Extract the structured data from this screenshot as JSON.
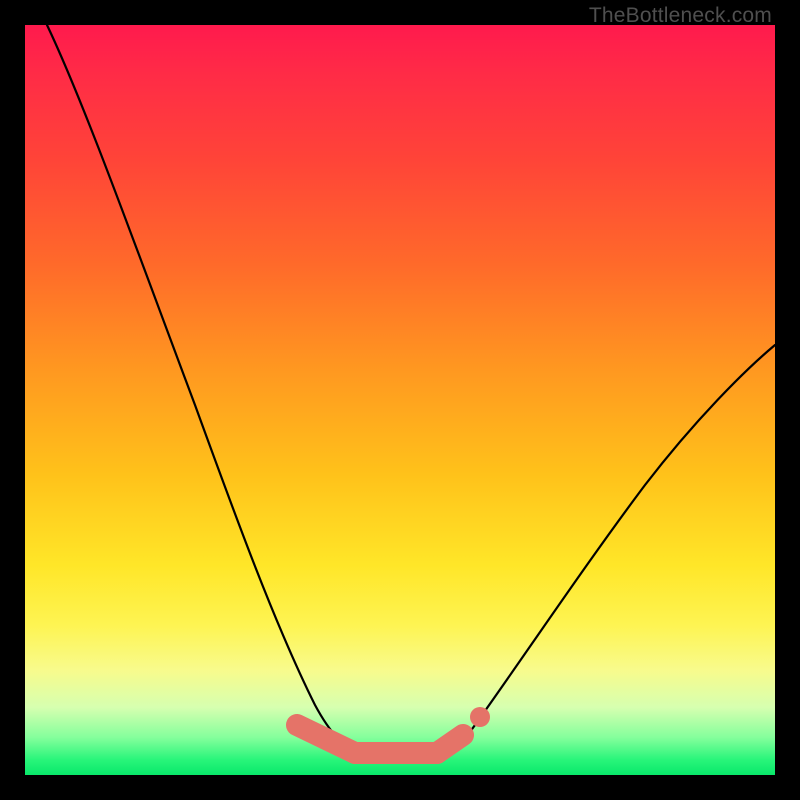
{
  "watermark": "TheBottleneck.com",
  "colors": {
    "frame": "#000000",
    "gradient_top": "#ff1a4d",
    "gradient_mid": "#ffe628",
    "gradient_bottom": "#09e86a",
    "curve": "#000000",
    "marker": "#e57368"
  },
  "chart_data": {
    "type": "line",
    "title": "",
    "xlabel": "",
    "ylabel": "",
    "xlim": [
      0,
      100
    ],
    "ylim": [
      0,
      100
    ],
    "grid": false,
    "legend": false,
    "annotations": [
      "TheBottleneck.com"
    ],
    "series": [
      {
        "name": "value-curve",
        "x": [
          3,
          6,
          10,
          14,
          18,
          22,
          26,
          30,
          33,
          36,
          38,
          40,
          42,
          44,
          46,
          48,
          50,
          54,
          58,
          62,
          66,
          70,
          74,
          78,
          82,
          86,
          90,
          94,
          98,
          100
        ],
        "y": [
          100,
          93,
          84,
          75,
          66,
          57,
          48,
          39,
          31,
          24,
          19,
          14,
          10,
          6,
          4,
          3,
          3,
          3,
          4,
          6,
          10,
          15,
          21,
          28,
          35,
          42,
          49,
          55,
          60,
          62
        ]
      }
    ],
    "markers": [
      {
        "name": "flat-segment-left",
        "x": [
          36,
          44
        ],
        "y": [
          5,
          3
        ]
      },
      {
        "name": "flat-segment-right",
        "x": [
          44,
          55
        ],
        "y": [
          3,
          3
        ]
      },
      {
        "name": "lift-segment",
        "x": [
          55,
          58
        ],
        "y": [
          3,
          5
        ]
      },
      {
        "name": "dot",
        "x": [
          60
        ],
        "y": [
          8
        ]
      }
    ]
  }
}
